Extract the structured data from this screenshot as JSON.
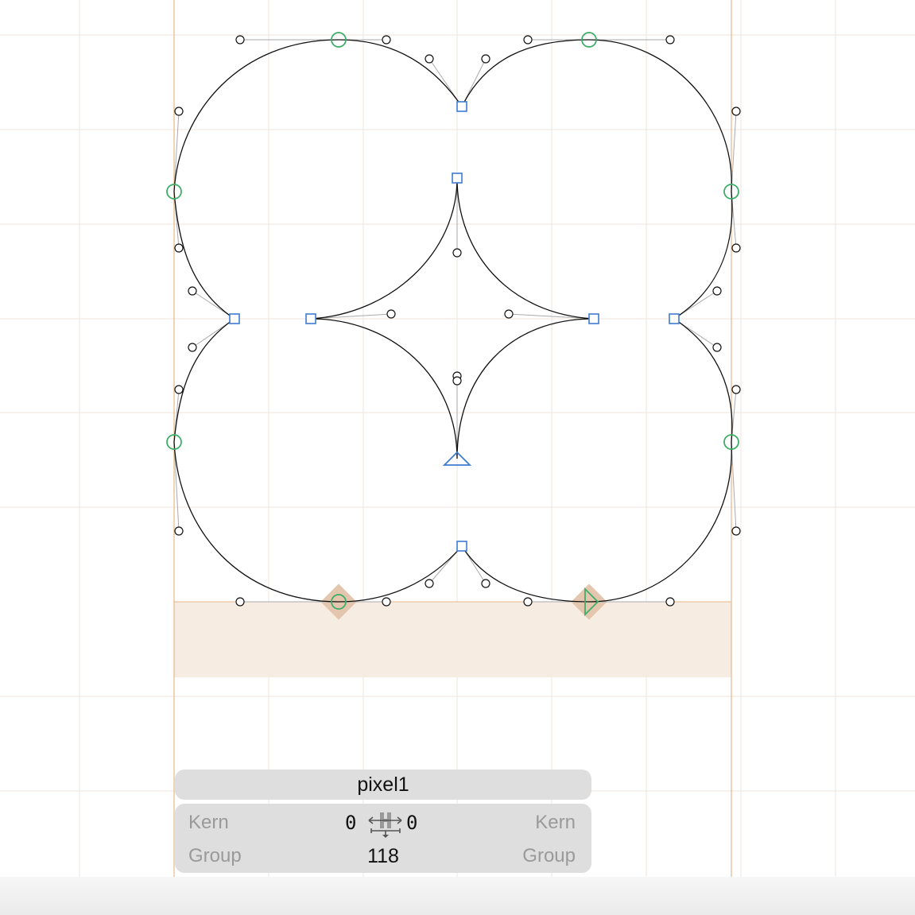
{
  "glyph": {
    "name": "pixel1"
  },
  "metrics": {
    "left_kern_label": "Kern",
    "left_group_label": "Group",
    "right_kern_label": "Kern",
    "right_group_label": "Group",
    "left_sidebearing": "0",
    "right_sidebearing": "0",
    "advance_width": "118"
  },
  "icons": {
    "metrics": "sidebearing-metrics-icon"
  },
  "colors": {
    "canvas": "#ffffff",
    "grid": "#efe6db",
    "metric_line": "#e6b68b",
    "baseline_band": "#f6ece2",
    "outline": "#111111",
    "handle": "#aaaaaa",
    "smooth_node": "#3fae68",
    "corner_node": "#3f7bd0",
    "anchor": "#e3c6ad",
    "panel": "#dedede",
    "label_muted": "#9a9a9a"
  }
}
